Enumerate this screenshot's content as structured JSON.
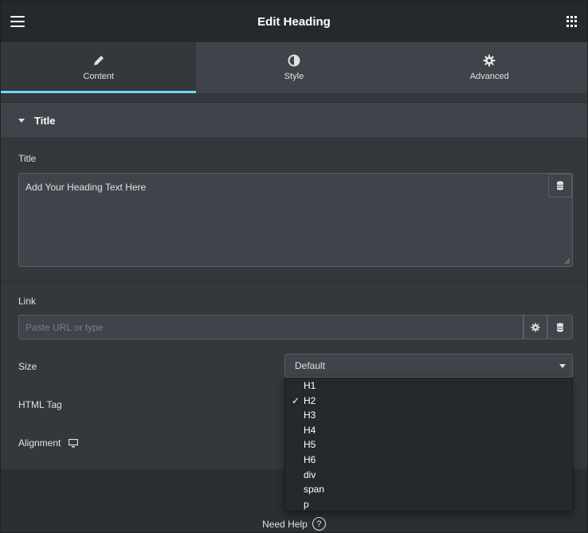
{
  "header": {
    "title": "Edit Heading",
    "menu_icon": "hamburger-icon",
    "apps_icon": "grid-icon"
  },
  "tabs": [
    {
      "label": "Content",
      "icon": "pencil-icon",
      "active": true
    },
    {
      "label": "Style",
      "icon": "half-circle-icon",
      "active": false
    },
    {
      "label": "Advanced",
      "icon": "gear-icon",
      "active": false
    }
  ],
  "section": {
    "title": "Title",
    "expanded": true
  },
  "title_field": {
    "label": "Title",
    "value": "Add Your Heading Text Here"
  },
  "link_field": {
    "label": "Link",
    "placeholder": "Paste URL or type"
  },
  "size_field": {
    "label": "Size",
    "value": "Default"
  },
  "html_tag_field": {
    "label": "HTML Tag",
    "selected": "H2",
    "options": [
      "H1",
      "H2",
      "H3",
      "H4",
      "H5",
      "H6",
      "div",
      "span",
      "p"
    ]
  },
  "alignment_field": {
    "label": "Alignment",
    "device_icon": "desktop-icon"
  },
  "footer": {
    "help_label": "Need Help",
    "help_icon": "?"
  },
  "colors": {
    "accent": "#71d7f7",
    "panel_bg": "#34383c",
    "header_bg": "#26292c"
  }
}
